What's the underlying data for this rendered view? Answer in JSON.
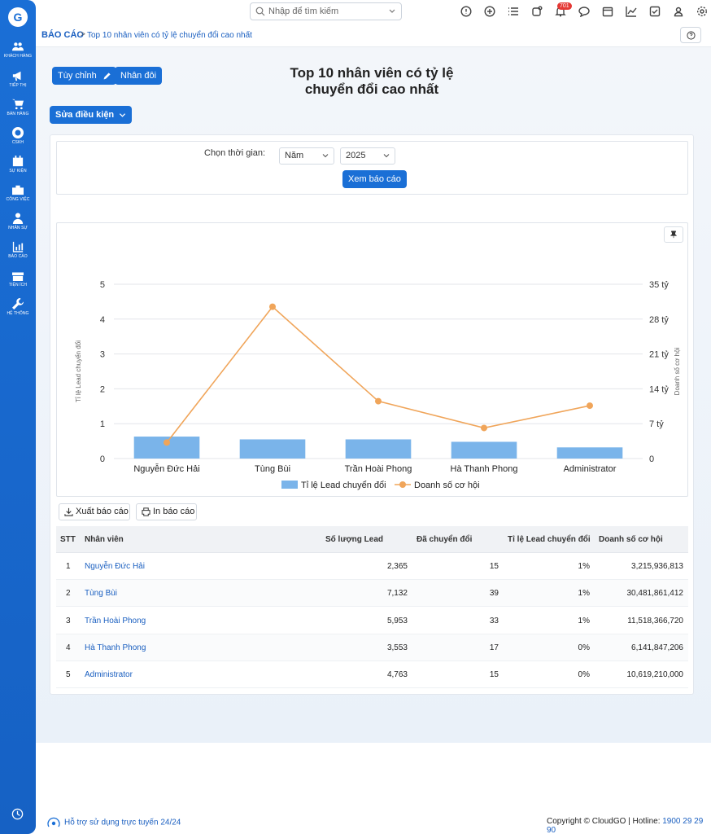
{
  "sidebar": {
    "logo": "G",
    "items": [
      {
        "label": "KHÁCH HÀNG",
        "icon": "customers-icon"
      },
      {
        "label": "TIẾP THỊ",
        "icon": "megaphone-icon"
      },
      {
        "label": "BÁN HÀNG",
        "icon": "cart-icon"
      },
      {
        "label": "CSKH",
        "icon": "lifebuoy-icon"
      },
      {
        "label": "SỰ KIỆN",
        "icon": "calendar-icon"
      },
      {
        "label": "CÔNG VIỆC",
        "icon": "briefcase-icon"
      },
      {
        "label": "NHÂN SỰ",
        "icon": "person-icon"
      },
      {
        "label": "BÁO CÁO",
        "icon": "report-icon"
      },
      {
        "label": "TIỆN ÍCH",
        "icon": "gift-icon"
      },
      {
        "label": "HỆ THỐNG",
        "icon": "wrench-icon"
      }
    ]
  },
  "topbar": {
    "search_placeholder": "Nhập để tìm kiếm",
    "notification_count": "701"
  },
  "breadcrumb": {
    "root": "BÁO CÁO",
    "separator": ">",
    "current": "Top 10 nhân viên có tỷ lệ chuyển đổi cao nhất"
  },
  "toolbar": {
    "customize_label": "Tùy chỉnh",
    "duplicate_label": "Nhân đôi",
    "edit_conditions_label": "Sửa điều kiện"
  },
  "page_title_line1": "Top 10 nhân viên có tỷ lệ",
  "page_title_line2": "chuyển đổi cao nhất",
  "filter": {
    "label": "Chọn thời gian:",
    "period_value": "Năm",
    "year_value": "2025",
    "submit_label": "Xem báo cáo"
  },
  "actions": {
    "export_label": "Xuất báo cáo",
    "print_label": "In báo cáo"
  },
  "chart_data": {
    "type": "bar+line",
    "categories": [
      "Nguyễn Đức Hải",
      "Tùng Bùi",
      "Trần Hoài Phong",
      "Hà Thanh Phong",
      "Administrator"
    ],
    "series": [
      {
        "name": "Tỉ lệ Lead chuyển đổi",
        "kind": "bar",
        "axis": "left",
        "color": "#7ab4ea",
        "values": [
          0.63,
          0.55,
          0.55,
          0.48,
          0.32
        ]
      },
      {
        "name": "Doanh số cơ hội",
        "kind": "line",
        "axis": "right",
        "color": "#f0a55a",
        "values": [
          3215936813,
          30481861412,
          11518366720,
          6141847206,
          10619210000
        ]
      }
    ],
    "ylabel": "Tỉ lệ Lead chuyển đổi",
    "y2label": "Doanh số cơ hội",
    "ylim": [
      0,
      5
    ],
    "y2lim": [
      0,
      35000000000
    ],
    "yticks": [
      "0",
      "1",
      "2",
      "3",
      "4",
      "5"
    ],
    "y2ticks": [
      "0",
      "7 tỷ",
      "14 tỷ",
      "21 tỷ",
      "28 tỷ",
      "35 tỷ"
    ],
    "grid": true,
    "legend": "bottom"
  },
  "table": {
    "headers": [
      "STT",
      "Nhân viên",
      "Số lượng Lead",
      "Đã chuyển đổi",
      "Tỉ lệ Lead chuyển đổi",
      "Doanh số cơ hội"
    ],
    "rows": [
      [
        "1",
        "Nguyễn Đức Hải",
        "2,365",
        "15",
        "1%",
        "3,215,936,813"
      ],
      [
        "2",
        "Tùng Bùi",
        "7,132",
        "39",
        "1%",
        "30,481,861,412"
      ],
      [
        "3",
        "Trần Hoài Phong",
        "5,953",
        "33",
        "1%",
        "11,518,366,720"
      ],
      [
        "4",
        "Hà Thanh Phong",
        "3,553",
        "17",
        "0%",
        "6,141,847,206"
      ],
      [
        "5",
        "Administrator",
        "4,763",
        "15",
        "0%",
        "10,619,210,000"
      ]
    ]
  },
  "footer": {
    "support_text": "Hỗ trợ sử dụng trực tuyến 24/24",
    "copyright_text": "Copyright © CloudGO | Hotline: ",
    "hotline": "1900 29 29 90"
  },
  "colors": {
    "primary": "#1a6fd6",
    "bar": "#7ab4ea",
    "line": "#f0a55a"
  }
}
